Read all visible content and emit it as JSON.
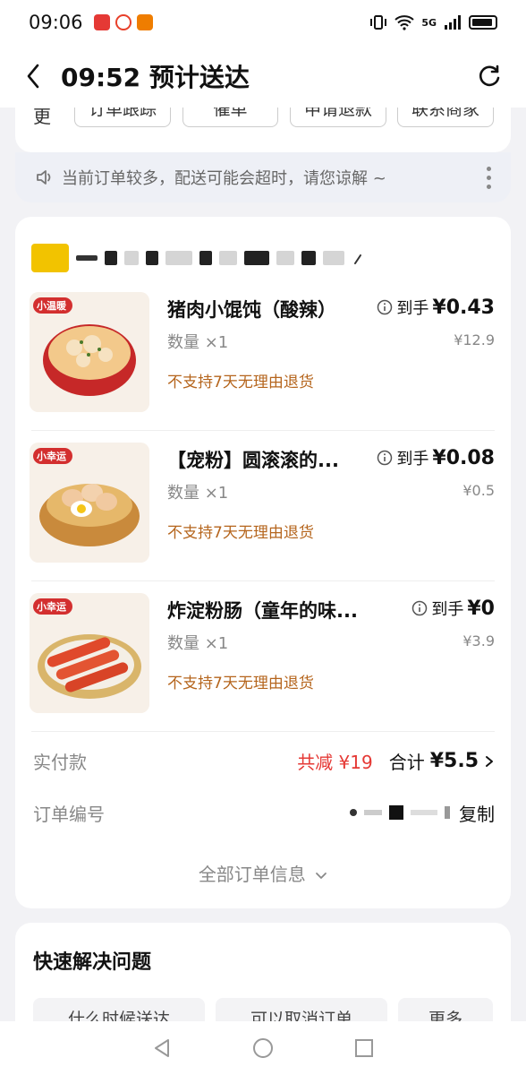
{
  "status_bar": {
    "time": "09:06",
    "network": "5G",
    "app_colors": [
      "#e53935",
      "#e8402a",
      "#ef7d00"
    ]
  },
  "header": {
    "title": "09:52 预计送达"
  },
  "top_card": {
    "partial_label": "更",
    "buttons": [
      "订单跟踪",
      "催单",
      "申请退款",
      "联系商家"
    ]
  },
  "notice": {
    "text": "当前订单较多，配送可能会超时，请您谅解 ~"
  },
  "items": [
    {
      "name": "猪肉小馄饨（酸辣）",
      "qty": "数量 ×1",
      "note": "不支持7天无理由退货",
      "price_label": "到手",
      "price": "¥0.43",
      "orig_price": "¥12.9",
      "tag": "小温暖"
    },
    {
      "name": "【宠粉】圆滚滚的...",
      "qty": "数量 ×1",
      "note": "不支持7天无理由退货",
      "price_label": "到手",
      "price": "¥0.08",
      "orig_price": "¥0.5",
      "tag": "小幸运"
    },
    {
      "name": "炸淀粉肠（童年的味...",
      "qty": "数量 ×1",
      "note": "不支持7天无理由退货",
      "price_label": "到手",
      "price": "¥0",
      "orig_price": "¥3.9",
      "tag": "小幸运"
    }
  ],
  "payment": {
    "label": "实付款",
    "discount": "共减 ¥19",
    "total_label": "合计",
    "total": "¥5.5"
  },
  "order_no": {
    "label": "订单编号",
    "copy": "复制"
  },
  "all_info": "全部订单信息",
  "quick": {
    "title": "快速解决问题",
    "chips": [
      "什么时候送达",
      "可以取消订单",
      "更多"
    ]
  }
}
